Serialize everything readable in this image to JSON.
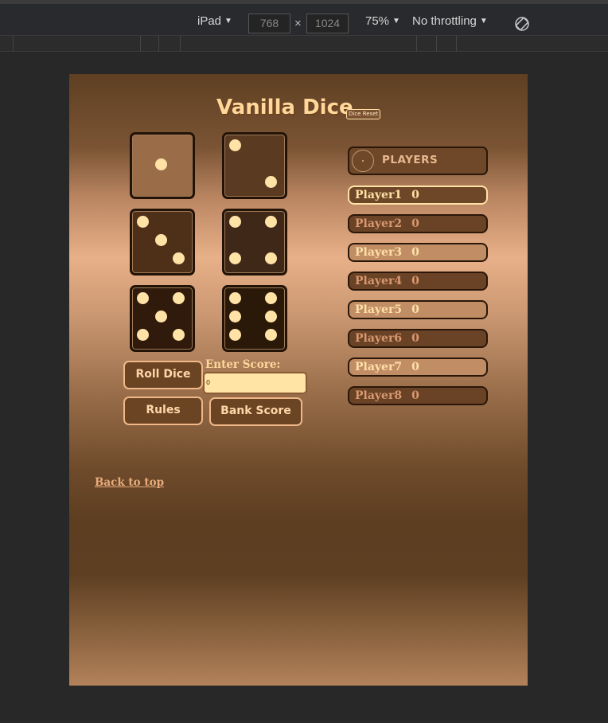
{
  "devtools": {
    "device": "iPad",
    "width": "768",
    "height": "1024",
    "times_symbol": "×",
    "zoom": "75%",
    "throttling": "No throttling",
    "caret": "▼"
  },
  "app": {
    "title": "Vanilla Dice",
    "reset_label": "Dice Reset",
    "dice": [
      {
        "value": 1,
        "color": "#9a6c48"
      },
      {
        "value": 2,
        "color": "#5a3a20"
      },
      {
        "value": 3,
        "color": "#4e3019"
      },
      {
        "value": 4,
        "color": "#3f2818"
      },
      {
        "value": 5,
        "color": "#2f1a0b"
      },
      {
        "value": 6,
        "color": "#2a1808"
      }
    ],
    "roll_label": "Roll Dice",
    "rules_label": "Rules",
    "bank_label": "Bank Score",
    "score_label": "Enter Score:",
    "score_value": "0",
    "back_link": "Back to top",
    "players_label": "PLAYERS",
    "players": [
      {
        "name": "Player1",
        "score": "0"
      },
      {
        "name": "Player2",
        "score": "0"
      },
      {
        "name": "Player3",
        "score": "0"
      },
      {
        "name": "Player4",
        "score": "0"
      },
      {
        "name": "Player5",
        "score": "0"
      },
      {
        "name": "Player6",
        "score": "0"
      },
      {
        "name": "Player7",
        "score": "0"
      },
      {
        "name": "Player8",
        "score": "0"
      }
    ]
  }
}
